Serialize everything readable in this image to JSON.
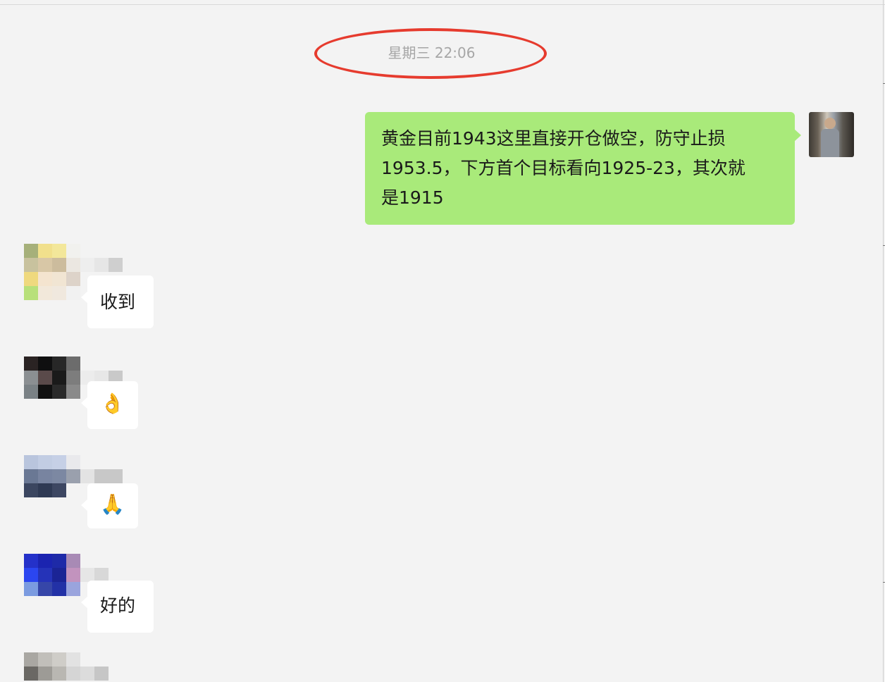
{
  "chat": {
    "timestamp": "星期三 22:06",
    "my_message": {
      "lines": [
        "黄金目前1943这里直接开仓做空，防守止损",
        "1953.5，下方首个目标看向1925-23，其次就",
        "是1915"
      ]
    },
    "replies": [
      {
        "text": "收到",
        "avatar_icon": "pixelated-avatar"
      },
      {
        "text": "👌",
        "icon": "ok-hand-emoji"
      },
      {
        "text": "🙏",
        "icon": "praying-hands-emoji"
      },
      {
        "text": "好的",
        "avatar_icon": "pixelated-avatar"
      }
    ]
  },
  "colors": {
    "background": "#f3f3f3",
    "my_bubble": "#a9ea7a",
    "other_bubble": "#ffffff",
    "timestamp_text": "#a6a6a6",
    "annotation_ellipse": "#e63b2e"
  }
}
